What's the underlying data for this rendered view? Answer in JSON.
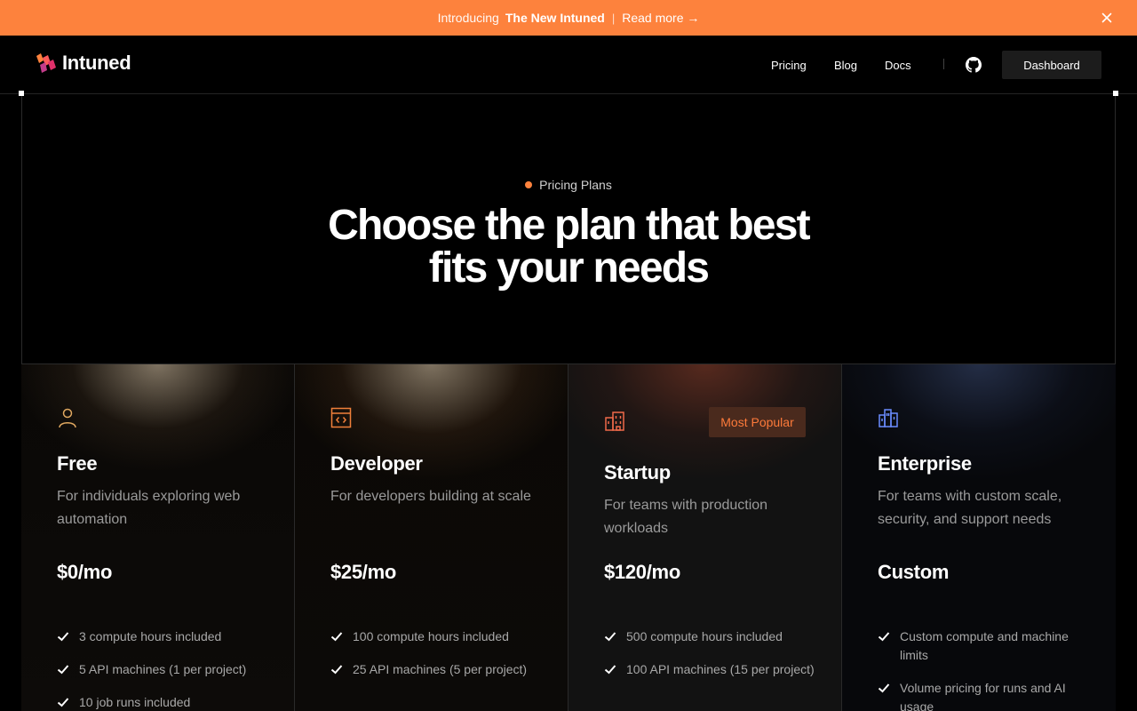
{
  "banner": {
    "intro": "Introducing",
    "highlight": "The New Intuned",
    "separator": "|",
    "link": "Read more →"
  },
  "nav": {
    "brand": "Intuned",
    "links": [
      "Pricing",
      "Blog",
      "Docs"
    ],
    "dashboard": "Dashboard"
  },
  "hero": {
    "eyebrow": "Pricing Plans",
    "title_line1": "Choose the plan that best",
    "title_line2": "fits your needs"
  },
  "plans": [
    {
      "name": "Free",
      "icon": "user-icon",
      "description": "For individuals exploring web automation",
      "price": "$0/mo",
      "features": [
        "3 compute hours included",
        "5 API machines (1 per project)",
        "10 job runs included"
      ]
    },
    {
      "name": "Developer",
      "icon": "code-window-icon",
      "description": "For developers building at scale",
      "price": "$25/mo",
      "features": [
        "100 compute hours included",
        "25 API machines (5 per project)"
      ]
    },
    {
      "name": "Startup",
      "icon": "building-icon",
      "badge": "Most Popular",
      "description": "For teams with production workloads",
      "price": "$120/mo",
      "features": [
        "500 compute hours included",
        "100 API machines (15 per project)"
      ]
    },
    {
      "name": "Enterprise",
      "icon": "city-icon",
      "description": "For teams with custom scale, security, and support needs",
      "price": "Custom",
      "features": [
        "Custom compute and machine limits",
        "Volume pricing for runs and AI usage"
      ]
    }
  ],
  "colors": {
    "accent": "#fd823d",
    "background": "#000000",
    "enterprise_icon": "#6b8cff",
    "badge_bg": "#4a2a1d"
  }
}
